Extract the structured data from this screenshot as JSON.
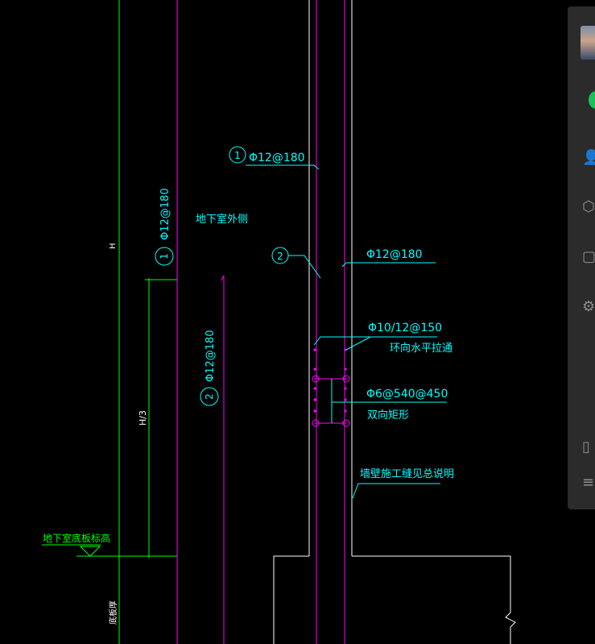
{
  "drawing": {
    "labels": {
      "top_rebar": "Φ12@180",
      "top_marker": "1",
      "vertical_rebar_1": "Φ12@180",
      "vertical_marker_1": "1",
      "exterior_side": "地下室外侧",
      "marker_2": "2",
      "right_rebar": "Φ12@180",
      "horizontal_bar": "Φ10/12@150",
      "ring_horizontal": "环向水平拉通",
      "tie_bar": "Φ6@540@450",
      "two_way_rect": "双向矩形",
      "wall_joint_note": "墙壁施工缝见总说明",
      "vertical_rebar_2": "Φ12@180",
      "vertical_marker_2": "2",
      "height_h": "H",
      "height_h3": "H/3",
      "basement_floor_level": "地下室底板标高",
      "bottom_label": "底板厚"
    },
    "colors": {
      "background": "#000000",
      "green": "#00ff00",
      "magenta": "#ff00ff",
      "cyan": "#00ffff",
      "white": "#ffffff"
    }
  },
  "sidebar": {
    "icons": [
      "avatar-icon",
      "chat-icon",
      "contacts-icon",
      "box-icon",
      "folder-icon",
      "settings-icon",
      "phone-icon",
      "menu-icon"
    ]
  }
}
